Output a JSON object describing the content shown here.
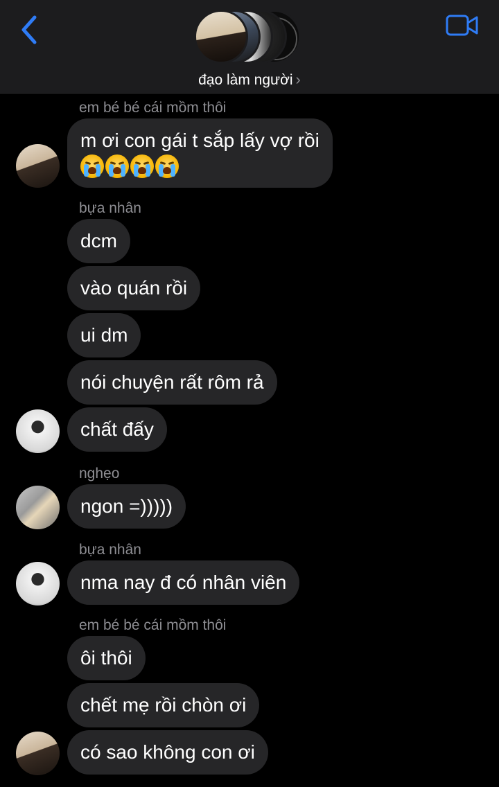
{
  "header": {
    "back_icon": "chevron-left-icon",
    "video_icon": "video-camera-icon",
    "group_name": "đạo làm người",
    "chevron": "›",
    "accent_color": "#2f7cf6"
  },
  "messages": [
    {
      "sender": "em bé bé cái mồm thôi",
      "text": "m ơi con gái t sắp lấy vợ rồi",
      "emoji": [
        "😭",
        "😭",
        "😭",
        "😭"
      ]
    },
    {
      "sender": "bựa nhân"
    },
    {
      "text": "dcm"
    },
    {
      "text": "vào quán rồi"
    },
    {
      "text": "ui dm"
    },
    {
      "text": "nói chuyện rất rôm rả"
    },
    {
      "text": "chất đấy"
    },
    {
      "sender": "nghẹo",
      "text": "ngon =)))))"
    },
    {
      "sender": "bựa nhân",
      "text": "nma nay đ có nhân viên"
    },
    {
      "sender": "em bé bé cái mồm thôi",
      "text": "ôi thôi"
    },
    {
      "text": "chết mẹ rồi chòn ơi"
    },
    {
      "text": "có sao không con ơi"
    }
  ]
}
